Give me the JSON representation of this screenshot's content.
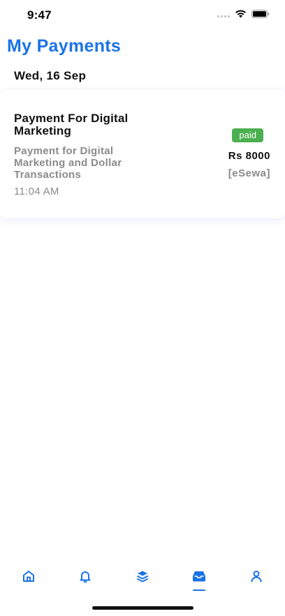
{
  "status_bar": {
    "time": "9:47"
  },
  "header": {
    "title": "My Payments"
  },
  "date_group": {
    "label": "Wed, 16 Sep"
  },
  "payment": {
    "title": "Payment For Digital Marketing",
    "description": "Payment for Digital Marketing and Dollar Transactions",
    "time": "11:04 AM",
    "status": "paid",
    "amount": "Rs 8000",
    "method": "[eSewa]"
  },
  "colors": {
    "accent": "#1a73e8",
    "paid": "#4caf50",
    "muted": "#8a8a8a"
  },
  "bottom_nav": {
    "items": [
      {
        "icon": "home-icon",
        "active": false
      },
      {
        "icon": "bell-icon",
        "active": false
      },
      {
        "icon": "layers-icon",
        "active": false
      },
      {
        "icon": "inbox-icon",
        "active": true
      },
      {
        "icon": "user-icon",
        "active": false
      }
    ]
  }
}
